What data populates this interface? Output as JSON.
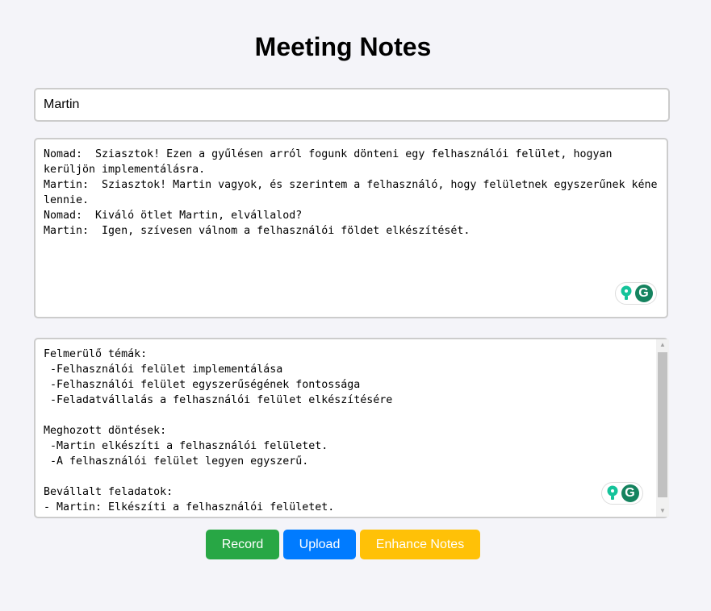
{
  "page": {
    "title": "Meeting Notes"
  },
  "name_input": {
    "value": "Martin"
  },
  "transcript": {
    "text": "Nomad:  Sziasztok! Ezen a gyűlésen arról fogunk dönteni egy felhasználói felület, hogyan kerüljön implementálásra.\nMartin:  Sziasztok! Martin vagyok, és szerintem a felhasználó, hogy felületnek egyszerűnek kéne lennie.\nNomad:  Kiváló ötlet Martin, elvállalod?\nMartin:  Igen, szívesen válnom a felhasználói földet elkészítését."
  },
  "notes": {
    "text": "Felmerülő témák:\n -Felhasználói felület implementálása\n -Felhasználói felület egyszerűségének fontossága\n -Feladatvállalás a felhasználói felület elkészítésére\n\nMeghozott döntések:\n -Martin elkészíti a felhasználói felületet.\n -A felhasználói felület legyen egyszerű.\n\nBevállalt feladatok:\n- Martin: Elkészíti a felhasználói felületet."
  },
  "grammarly": {
    "letter": "G",
    "icons": [
      "lightbulb-icon",
      "grammarly-icon"
    ]
  },
  "buttons": {
    "record": "Record",
    "upload": "Upload",
    "enhance": "Enhance Notes"
  },
  "colors": {
    "record": "#28a745",
    "upload": "#007bff",
    "enhance": "#ffc107",
    "grammarly": "#15835f"
  }
}
